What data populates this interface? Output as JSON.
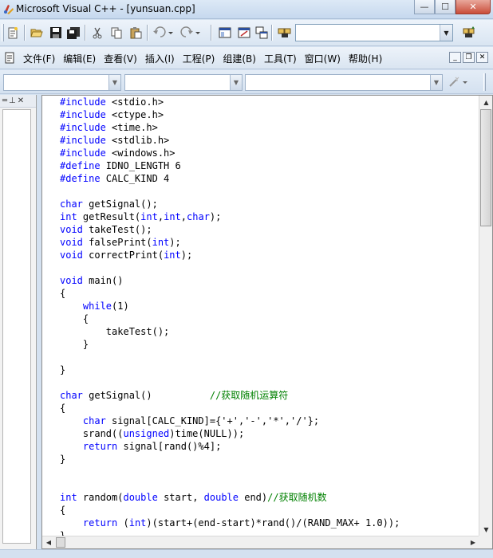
{
  "window": {
    "title": "Microsoft Visual C++ - [yunsuan.cpp]",
    "minimize_glyph": "—",
    "maximize_glyph": "☐",
    "close_glyph": "✕"
  },
  "toolbar": {
    "find_combo_value": "",
    "icons": [
      "new-text-file-icon",
      "open-folder-icon",
      "save-icon",
      "save-all-icon",
      "cut-icon",
      "copy-icon",
      "paste-icon",
      "undo-icon",
      "redo-icon",
      "workspace-icon",
      "output-icon",
      "window-list-icon",
      "find-in-files-icon",
      "search-icon"
    ]
  },
  "menu": {
    "items": [
      "文件(F)",
      "编辑(E)",
      "查看(V)",
      "插入(I)",
      "工程(P)",
      "组建(B)",
      "工具(T)",
      "窗口(W)",
      "帮助(H)"
    ],
    "mdi_minimize": "_",
    "mdi_restore": "❐",
    "mdi_close": "✕"
  },
  "wizardbar": {
    "class_combo": "",
    "filter_combo": "",
    "members_combo": ""
  },
  "workspace": {
    "header_glyphs": [
      "═",
      "⊥",
      "✕"
    ]
  },
  "editor": {
    "lines": [
      [
        {
          "t": "#include",
          "c": "kw"
        },
        {
          "t": " <stdio.h>"
        }
      ],
      [
        {
          "t": "#include",
          "c": "kw"
        },
        {
          "t": " <ctype.h>"
        }
      ],
      [
        {
          "t": "#include",
          "c": "kw"
        },
        {
          "t": " <time.h>"
        }
      ],
      [
        {
          "t": "#include",
          "c": "kw"
        },
        {
          "t": " <stdlib.h>"
        }
      ],
      [
        {
          "t": "#include",
          "c": "kw"
        },
        {
          "t": " <windows.h>"
        }
      ],
      [
        {
          "t": "#define",
          "c": "kw"
        },
        {
          "t": " IDNO_LENGTH 6"
        }
      ],
      [
        {
          "t": "#define",
          "c": "kw"
        },
        {
          "t": " CALC_KIND 4"
        }
      ],
      [],
      [
        {
          "t": "char",
          "c": "kw"
        },
        {
          "t": " getSignal();"
        }
      ],
      [
        {
          "t": "int",
          "c": "kw"
        },
        {
          "t": " getResult("
        },
        {
          "t": "int",
          "c": "kw"
        },
        {
          "t": ","
        },
        {
          "t": "int",
          "c": "kw"
        },
        {
          "t": ","
        },
        {
          "t": "char",
          "c": "kw"
        },
        {
          "t": ");"
        }
      ],
      [
        {
          "t": "void",
          "c": "kw"
        },
        {
          "t": " takeTest();"
        }
      ],
      [
        {
          "t": "void",
          "c": "kw"
        },
        {
          "t": " falsePrint("
        },
        {
          "t": "int",
          "c": "kw"
        },
        {
          "t": ");"
        }
      ],
      [
        {
          "t": "void",
          "c": "kw"
        },
        {
          "t": " correctPrint("
        },
        {
          "t": "int",
          "c": "kw"
        },
        {
          "t": ");"
        }
      ],
      [],
      [
        {
          "t": "void",
          "c": "kw"
        },
        {
          "t": " main()"
        }
      ],
      [
        {
          "t": "{"
        }
      ],
      [
        {
          "t": "    "
        },
        {
          "t": "while",
          "c": "kw"
        },
        {
          "t": "(1)"
        }
      ],
      [
        {
          "t": "    {"
        }
      ],
      [
        {
          "t": "        takeTest();"
        }
      ],
      [
        {
          "t": "    }"
        }
      ],
      [],
      [
        {
          "t": "}"
        }
      ],
      [],
      [
        {
          "t": "char",
          "c": "kw"
        },
        {
          "t": " getSignal()          "
        },
        {
          "t": "//获取随机运算符",
          "c": "cm"
        }
      ],
      [
        {
          "t": "{"
        }
      ],
      [
        {
          "t": "    "
        },
        {
          "t": "char",
          "c": "kw"
        },
        {
          "t": " signal[CALC_KIND]={'+','-','*','/'};"
        }
      ],
      [
        {
          "t": "    srand(("
        },
        {
          "t": "unsigned",
          "c": "kw"
        },
        {
          "t": ")time(NULL));"
        }
      ],
      [
        {
          "t": "    "
        },
        {
          "t": "return",
          "c": "kw"
        },
        {
          "t": " signal[rand()%4];"
        }
      ],
      [
        {
          "t": "}"
        }
      ],
      [],
      [],
      [
        {
          "t": "int",
          "c": "kw"
        },
        {
          "t": " random("
        },
        {
          "t": "double",
          "c": "kw"
        },
        {
          "t": " start, "
        },
        {
          "t": "double",
          "c": "kw"
        },
        {
          "t": " end)"
        },
        {
          "t": "//获取随机数",
          "c": "cm"
        }
      ],
      [
        {
          "t": "{"
        }
      ],
      [
        {
          "t": "    "
        },
        {
          "t": "return",
          "c": "kw"
        },
        {
          "t": " ("
        },
        {
          "t": "int",
          "c": "kw"
        },
        {
          "t": ")(start+(end-start)*rand()/(RAND_MAX+ 1.0));"
        }
      ],
      [
        {
          "t": "}"
        }
      ]
    ]
  }
}
